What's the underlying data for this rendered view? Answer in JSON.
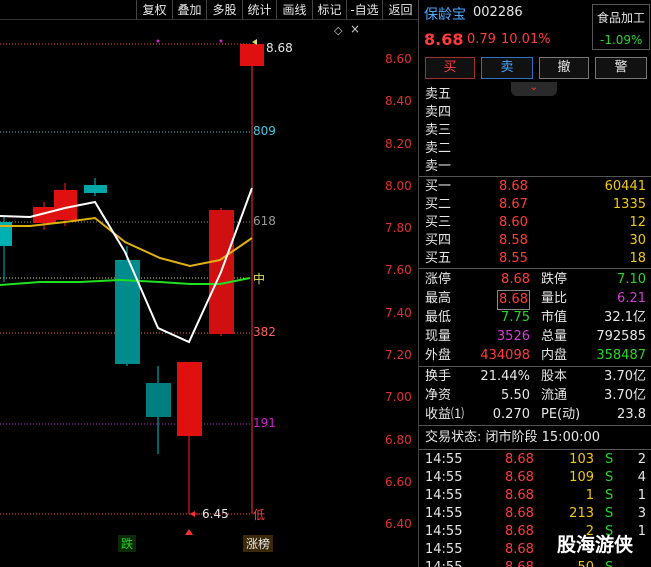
{
  "toolbar": {
    "buttons": [
      "复权",
      "叠加",
      "多股",
      "统计",
      "画线",
      "标记",
      "-自选",
      "返回"
    ]
  },
  "chart": {
    "price_labels": [
      "8.60",
      "8.40",
      "8.20",
      "8.00",
      "7.80",
      "7.60",
      "7.40",
      "7.20",
      "7.00",
      "6.80",
      "6.60",
      "6.40"
    ],
    "fib_labels": {
      "f809": "809",
      "f618": "618",
      "f500": "中",
      "f382": "382",
      "f191": "191",
      "low_tag": "低"
    },
    "high_label": "8.68",
    "low_label": "6.45",
    "bottom_tags": {
      "drop": "跌",
      "limit_up": "涨榜"
    },
    "diamond_icon": "◇",
    "close_icon": "×",
    "colors": {
      "up": "#ff2020",
      "down": "#00c8c8",
      "ma_white": "#ffffff",
      "ma_yellow": "#e0b010",
      "ma_green": "#20e020",
      "fib_cyan": "#40c8e0",
      "fib_purple": "#d020d0"
    }
  },
  "panel": {
    "stock_name": "保龄宝",
    "stock_code": "002286",
    "price": "8.68",
    "change": "0.79",
    "change_pct": "10.01%",
    "sector": {
      "name": "食品加工",
      "pct": "-1.09%"
    },
    "actions": {
      "buy": "买",
      "sell": "卖",
      "cancel": "撤",
      "alert": "警"
    },
    "asks": [
      "卖五",
      "卖四",
      "卖三",
      "卖二",
      "卖一"
    ],
    "bids": [
      {
        "label": "买一",
        "price": "8.68",
        "vol": "60441"
      },
      {
        "label": "买二",
        "price": "8.67",
        "vol": "1335"
      },
      {
        "label": "买三",
        "price": "8.60",
        "vol": "12"
      },
      {
        "label": "买四",
        "price": "8.58",
        "vol": "30"
      },
      {
        "label": "买五",
        "price": "8.55",
        "vol": "18"
      }
    ],
    "stats": [
      {
        "k1": "涨停",
        "v1": "8.68",
        "k2": "跌停",
        "v2": "7.10"
      },
      {
        "k1": "最高",
        "v1": "8.68",
        "k2": "量比",
        "v2": "6.21"
      },
      {
        "k1": "最低",
        "v1": "7.75",
        "k2": "市值",
        "v2": "32.1亿"
      },
      {
        "k1": "现量",
        "v1": "3526",
        "k2": "总量",
        "v2": "792585"
      },
      {
        "k1": "外盘",
        "v1": "434098",
        "k2": "内盘",
        "v2": "358487"
      }
    ],
    "fundamentals": [
      {
        "k1": "换手",
        "v1": "21.44%",
        "k2": "股本",
        "v2": "3.70亿"
      },
      {
        "k1": "净资",
        "v1": "5.50",
        "k2": "流通",
        "v2": "3.70亿"
      },
      {
        "k1": "收益⑴",
        "v1": "0.270",
        "k2": "PE(动)",
        "v2": "23.8"
      }
    ],
    "trade_status": "交易状态: 闭市阶段 15:00:00",
    "ticks": [
      {
        "time": "14:55",
        "price": "8.68",
        "vol": "103",
        "side": "S",
        "n": "2"
      },
      {
        "time": "14:55",
        "price": "8.68",
        "vol": "109",
        "side": "S",
        "n": "4"
      },
      {
        "time": "14:55",
        "price": "8.68",
        "vol": "1",
        "side": "S",
        "n": "1"
      },
      {
        "time": "14:55",
        "price": "8.68",
        "vol": "213",
        "side": "S",
        "n": "3"
      },
      {
        "time": "14:55",
        "price": "8.68",
        "vol": "2",
        "side": "S",
        "n": "1"
      },
      {
        "time": "14:55",
        "price": "8.68",
        "vol": "",
        "side": "",
        "n": ""
      },
      {
        "time": "14:55",
        "price": "8.68",
        "vol": "50",
        "side": "S",
        "n": ""
      }
    ],
    "watermark": "股海游侠"
  }
}
